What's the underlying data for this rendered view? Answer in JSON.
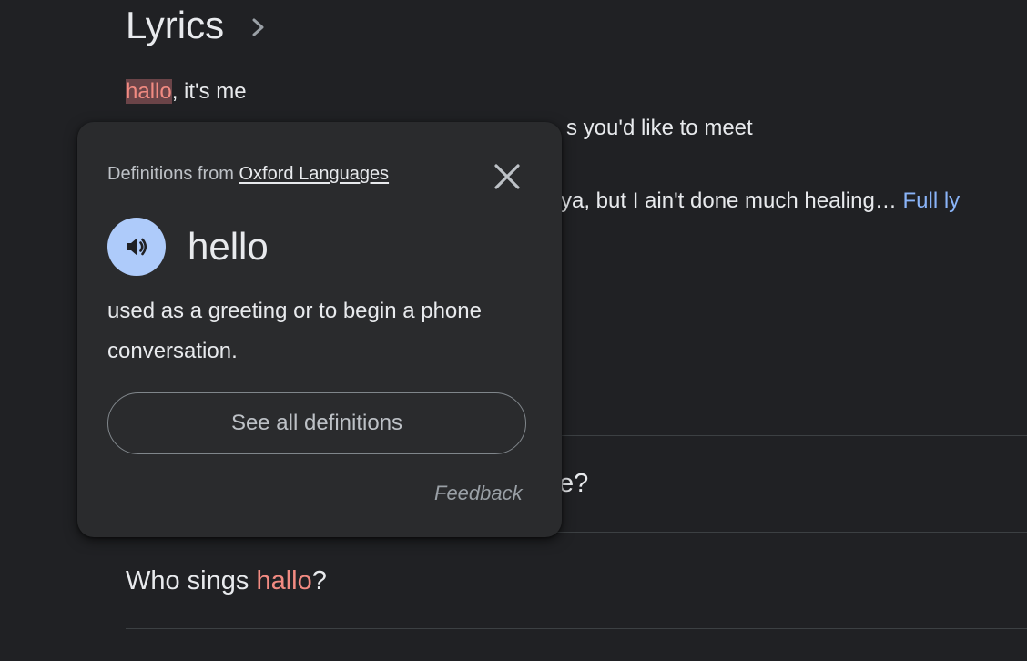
{
  "lyrics": {
    "title": "Lyrics",
    "line1_highlight": "hallo",
    "line1_rest": ", it's me",
    "line2_visible": "s you'd like to meet",
    "line3_visible": "ya, but I ain't done much healing…",
    "full_lyrics_link": "Full ly"
  },
  "faq": {
    "q1_visible": "e?",
    "q2_prefix": "Who sings ",
    "q2_highlight": "hallo",
    "q2_suffix": "?"
  },
  "popup": {
    "source_prefix": "Definitions from ",
    "source_link": "Oxford Languages",
    "word": "hello",
    "definition": "used as a greeting or to begin a phone conversation.",
    "see_all_label": "See all definitions",
    "feedback_label": "Feedback",
    "close_icon": "close-icon",
    "speaker_icon": "speaker-icon"
  },
  "colors": {
    "background": "#202124",
    "popup_bg": "#2a2b2d",
    "highlight_text": "#f28b82",
    "link_blue": "#8ab4f8",
    "speaker_bg": "#aecbfa"
  }
}
